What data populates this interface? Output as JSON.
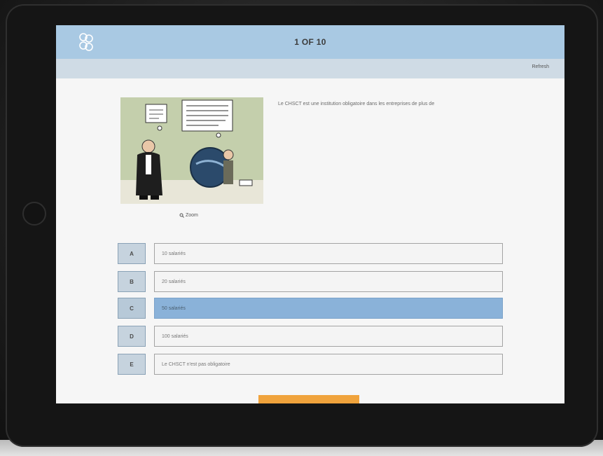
{
  "header": {
    "counter": "1 OF 10",
    "logo_icon": "hexagon-molecule-icon"
  },
  "subbar": {
    "refresh_label": "Refresh"
  },
  "media": {
    "zoom_label": "Zoom"
  },
  "question": {
    "text": "Le CHSCT est une institution obligatoire dans les entreprises de plus de"
  },
  "answers": [
    {
      "letter": "A",
      "text": "10 salariés"
    },
    {
      "letter": "B",
      "text": "20 salariés"
    },
    {
      "letter": "C",
      "text": "50 salariés"
    },
    {
      "letter": "D",
      "text": "100 salariés"
    },
    {
      "letter": "E",
      "text": "Le CHSCT n'est pas obligatoire"
    }
  ],
  "selected_answer": "C",
  "colors": {
    "header_bar": "#a9c9e3",
    "sub_bar": "#cfdbe5",
    "selected_answer": "#8ab2d9",
    "progress_tab": "#f0a33c"
  }
}
